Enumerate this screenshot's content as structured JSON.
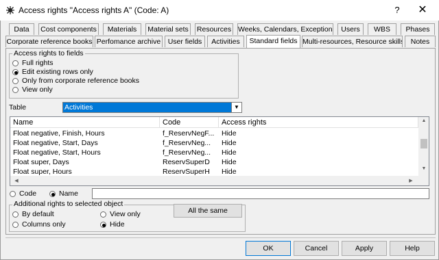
{
  "window": {
    "title": "Access rights \"Access rights A\" (Code: A)",
    "help_glyph": "?",
    "close_glyph": "✕"
  },
  "tabs_row1": [
    "Data",
    "Cost components",
    "Materials",
    "Material sets",
    "Resources",
    "Weeks, Calendars, Exceptions",
    "Users",
    "WBS",
    "Phases"
  ],
  "tabs_row2": [
    "Corporate reference books",
    "Perfomance archive",
    "User fields",
    "Activities",
    "Standard fields",
    "Multi-resources, Resource skills",
    "Notes"
  ],
  "active_tab": "Standard fields",
  "access_group": {
    "caption": "Access rights to fields",
    "options": [
      "Full rights",
      "Edit existing rows only",
      "Only from corporate reference books",
      "View only"
    ],
    "selected": "Edit existing rows only"
  },
  "table_select": {
    "label": "Table",
    "value": "Activities",
    "arrow": "▼"
  },
  "grid": {
    "headers": [
      "Name",
      "Code",
      "Access rights"
    ],
    "rows": [
      [
        "Float negative, Finish, Hours",
        "f_ReservNegF...",
        "Hide"
      ],
      [
        "Float negative, Start, Days",
        "f_ReservNeg...",
        "Hide"
      ],
      [
        "Float negative, Start, Hours",
        "f_ReservNeg...",
        "Hide"
      ],
      [
        "Float super, Days",
        "ReservSuperD",
        "Hide"
      ],
      [
        "Float super, Hours",
        "ReservSuperH",
        "Hide"
      ]
    ],
    "arrow_up": "▲",
    "arrow_down": "▼",
    "arrow_left": "◀",
    "arrow_right": "▶"
  },
  "search": {
    "code_label": "Code",
    "name_label": "Name",
    "selected": "Name",
    "value": ""
  },
  "additional_group": {
    "caption": "Additional rights to selected object",
    "options": [
      "By default",
      "View only",
      "Columns only",
      "Hide"
    ],
    "selected": "Hide",
    "all_same_label": "All the same"
  },
  "buttons": {
    "ok": "OK",
    "cancel": "Cancel",
    "apply": "Apply",
    "help": "Help"
  }
}
